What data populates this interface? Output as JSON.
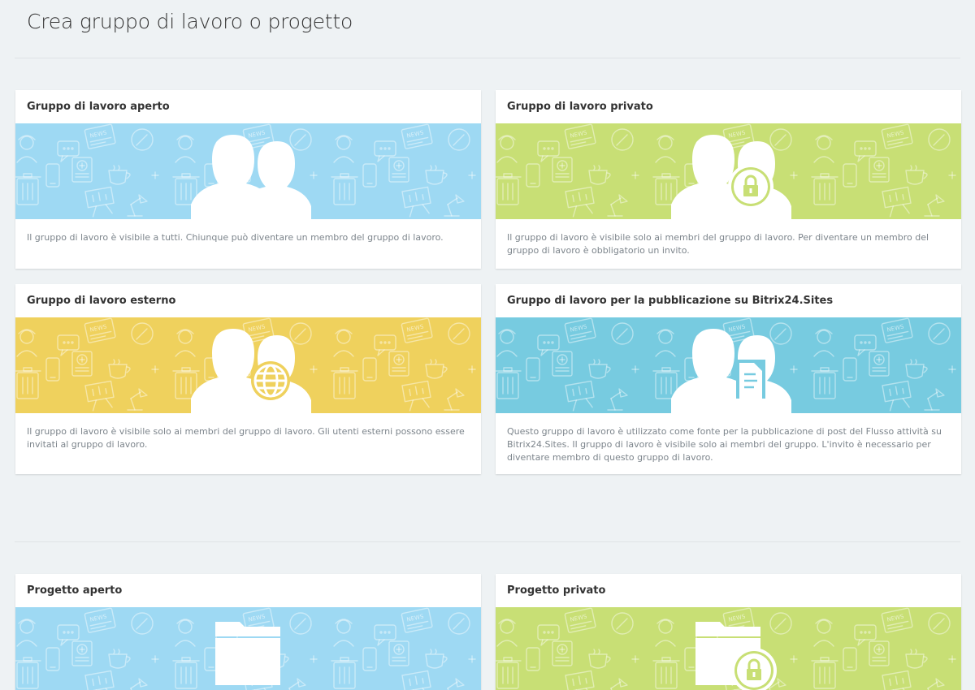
{
  "page": {
    "title": "Crea gruppo di lavoro o progetto"
  },
  "cards": [
    {
      "title": "Gruppo di lavoro aperto",
      "description": "Il gruppo di lavoro è visibile a tutti. Chiunque può diventare un membro del gruppo di lavoro.",
      "color": "#9ed9f3",
      "icon": "people-icon"
    },
    {
      "title": "Gruppo di lavoro privato",
      "description": "Il gruppo di lavoro è visibile solo ai membri del gruppo di lavoro. Per diventare un membro del gruppo di lavoro è obbligatorio un invito.",
      "color": "#c8df75",
      "icon": "people-lock-icon"
    },
    {
      "title": "Gruppo di lavoro esterno",
      "description": "Il gruppo di lavoro è visibile solo ai membri del gruppo di lavoro. Gli utenti esterni possono essere invitati al gruppo di lavoro.",
      "color": "#efd15d",
      "icon": "people-globe-icon"
    },
    {
      "title": "Gruppo di lavoro per la pubblicazione su Bitrix24.Sites",
      "description": "Questo gruppo di lavoro è utilizzato come fonte per la pubblicazione di post del Flusso attività su Bitrix24.Sites. Il gruppo di lavoro è visibile solo ai membri del gruppo. L'invito è necessario per diventare membro di questo gruppo di lavoro.",
      "color": "#77cbe0",
      "icon": "people-document-icon"
    },
    {
      "title": "Progetto aperto",
      "description": "",
      "color": "#9ed9f3",
      "icon": "folder-icon"
    },
    {
      "title": "Progetto privato",
      "description": "",
      "color": "#c8df75",
      "icon": "folder-lock-icon"
    }
  ]
}
